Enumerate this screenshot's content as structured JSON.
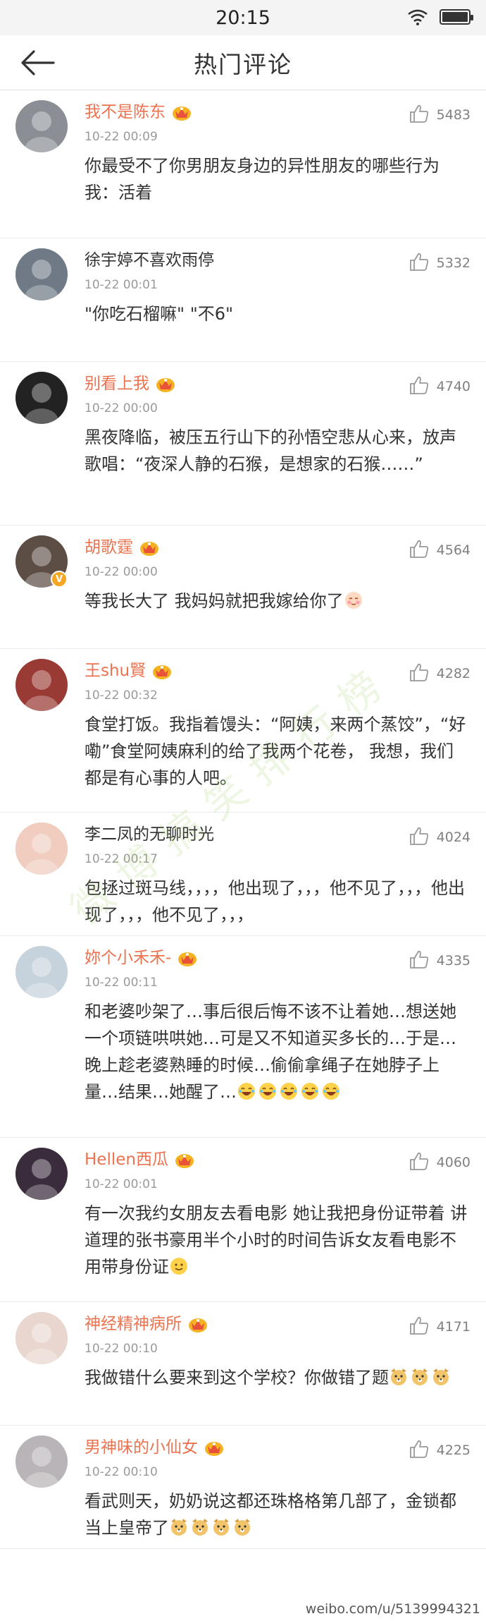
{
  "status_bar": {
    "time": "20:15"
  },
  "header": {
    "title": "热门评论"
  },
  "comments": [
    {
      "user": "我不是陈东",
      "vip": true,
      "verified": false,
      "time": "10-22 00:09",
      "likes": "5483",
      "text": "你最受不了你男朋友身边的异性朋友的哪些行为    我：活着",
      "avatar_color": "#8b8f95"
    },
    {
      "user": "徐宇婷不喜欢雨停",
      "vip": false,
      "verified": false,
      "time": "10-22 00:01",
      "likes": "5332",
      "text": "\"你吃石榴嘛\" \"不6\"",
      "avatar_color": "#6f7a86"
    },
    {
      "user": "别看上我",
      "vip": true,
      "verified": false,
      "time": "10-22 00:00",
      "likes": "4740",
      "text": "黑夜降临，被压五行山下的孙悟空悲从心来，放声歌唱：“夜深人静的石猴，是想家的石猴……”",
      "avatar_color": "#222222"
    },
    {
      "user": "胡歌霆",
      "vip": true,
      "verified": true,
      "time": "10-22 00:00",
      "likes": "4564",
      "text": "等我长大了 我妈妈就把我嫁给你了",
      "avatar_color": "#5c4d45"
    },
    {
      "user": "王shu賢",
      "vip": true,
      "verified": false,
      "time": "10-22 00:32",
      "likes": "4282",
      "text": "食堂打饭。我指着馒头：“阿姨，来两个蒸饺”，“好嘞”食堂阿姨麻利的给了我两个花卷，      我想，我们都是有心事的人吧。",
      "avatar_color": "#9a3a34"
    },
    {
      "user": "李二凤的无聊时光",
      "vip": false,
      "verified": false,
      "time": "10-22 00:17",
      "likes": "4024",
      "text": "包拯过斑马线，，，，他出现了，，，他不见了，，，他出现了，，，他不见了，，，",
      "avatar_color": "#f0cdbf"
    },
    {
      "user": "妳个小禾禾-",
      "vip": true,
      "verified": false,
      "time": "10-22 00:11",
      "likes": "4335",
      "text": "和老婆吵架了…事后很后悔不该不让着她…想送她一个项链哄哄她…可是又不知道买多长的…于是…晚上趁老婆熟睡的时候…偷偷拿绳子在她脖子上量…结果…她醒了…",
      "avatar_color": "#c6d3dc"
    },
    {
      "user": "Hellen西瓜",
      "vip": true,
      "verified": false,
      "time": "10-22 00:01",
      "likes": "4060",
      "text": "有一次我约女朋友去看电影 她让我把身份证带着 讲道理的张书豪用半个小时的时间告诉女友看电影不用带身份证",
      "avatar_color": "#3a2c3c"
    },
    {
      "user": "神经精神病所",
      "vip": true,
      "verified": false,
      "time": "10-22 00:10",
      "likes": "4171",
      "text": "我做错什么要来到这个学校？你做错了题",
      "avatar_color": "#e9d7cf"
    },
    {
      "user": "男神味的小仙女",
      "vip": true,
      "verified": false,
      "time": "10-22 00:10",
      "likes": "4225",
      "text": "看武则天，奶奶说这都还珠格格第几部了，金锁都当上皇帝了",
      "avatar_color": "#b9b4b8"
    }
  ],
  "watermark": "微博搞笑排行榜",
  "footer": {
    "mark": "weibo.com/u/5139994321"
  }
}
